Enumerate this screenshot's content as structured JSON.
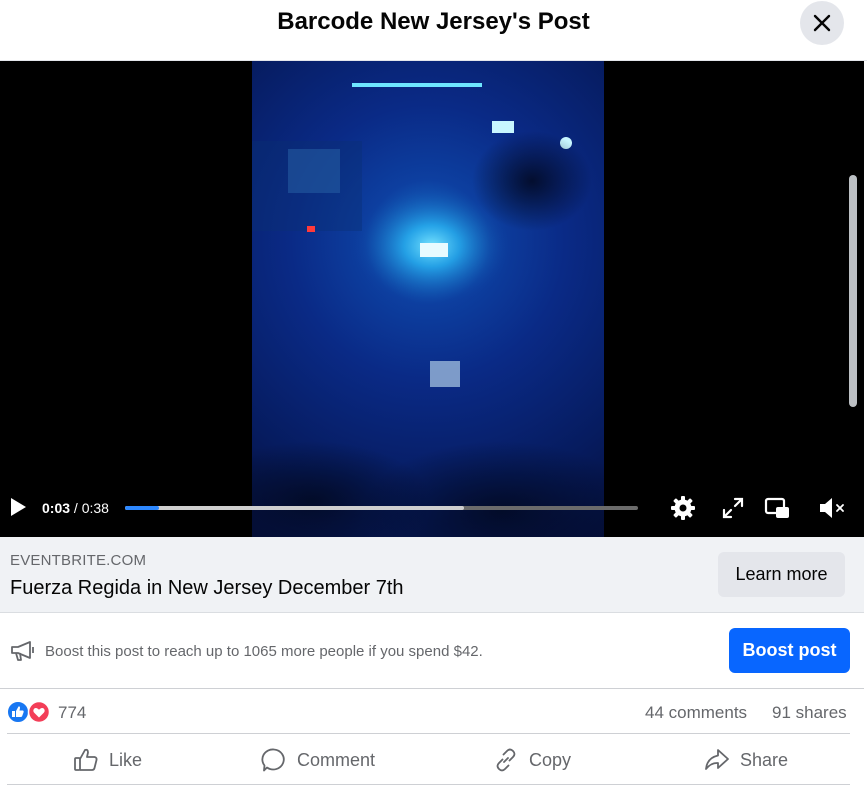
{
  "header": {
    "title": "Barcode New Jersey's Post",
    "close_icon": "close-icon"
  },
  "video": {
    "current_time": "0:03",
    "separator": " / ",
    "duration": "0:38",
    "played_fraction": 0.066,
    "buffered_fraction": 0.66,
    "accent": "#2d88ff",
    "icons": [
      "play-icon",
      "settings-icon",
      "fullscreen-icon",
      "picture-in-picture-icon",
      "muted-volume-icon"
    ]
  },
  "link_preview": {
    "domain": "EVENTBRITE.COM",
    "title": "Fuerza Regida in New Jersey December 7th",
    "button": "Learn more"
  },
  "boost": {
    "text": "Boost this post to reach up to 1065 more people if you spend $42.",
    "button": "Boost post",
    "button_color": "#0866ff",
    "icon": "megaphone-icon"
  },
  "stats": {
    "reaction_count": "774",
    "comments": "44 comments",
    "shares": "91 shares",
    "reaction_icons": [
      "like-reaction-icon",
      "love-reaction-icon"
    ]
  },
  "actions": {
    "like": "Like",
    "comment": "Comment",
    "copy": "Copy",
    "share": "Share"
  }
}
